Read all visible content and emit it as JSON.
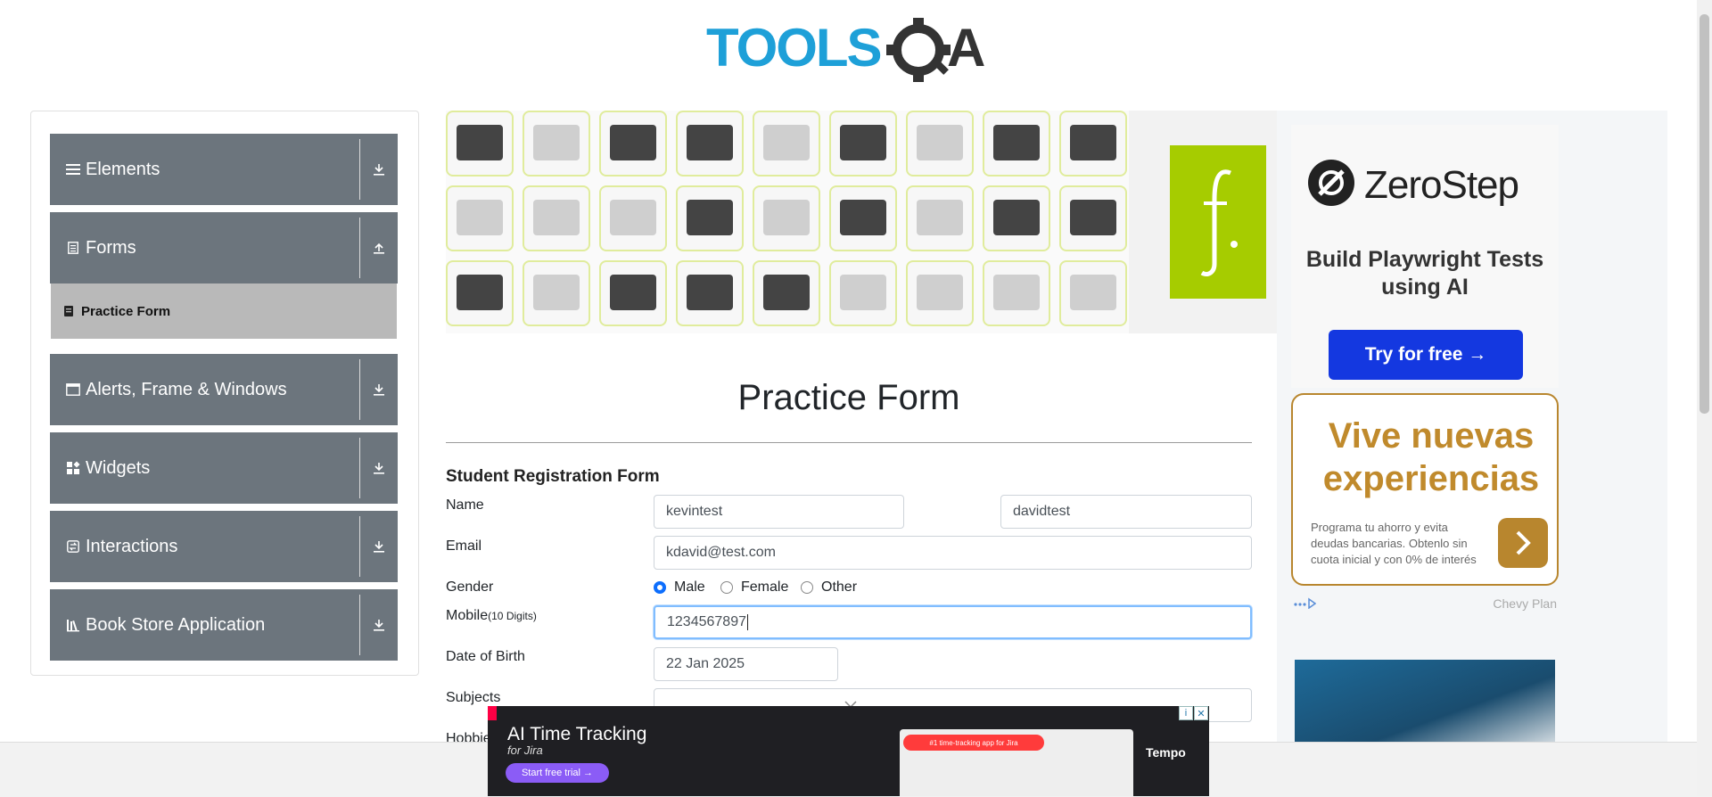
{
  "logo": {
    "text": "TOOLSQA",
    "left_part": "TOOLS",
    "right_part": "A"
  },
  "sidebar": {
    "groups": [
      {
        "label": "Elements",
        "icon": "hamburger-icon",
        "arrow": "download-icon"
      },
      {
        "label": "Forms",
        "icon": "document-icon",
        "arrow": "upload-icon"
      },
      {
        "label": "Alerts, Frame & Windows",
        "icon": "window-icon",
        "arrow": "download-icon"
      },
      {
        "label": "Widgets",
        "icon": "widgets-icon",
        "arrow": "download-icon"
      },
      {
        "label": "Interactions",
        "icon": "interaction-icon",
        "arrow": "download-icon"
      },
      {
        "label": "Book Store Application",
        "icon": "books-icon",
        "arrow": "download-icon"
      }
    ],
    "active_item": "Practice Form"
  },
  "form": {
    "title": "Practice Form",
    "subtitle": "Student Registration Form",
    "labels": {
      "name": "Name",
      "email": "Email",
      "gender": "Gender",
      "mobile": "Mobile",
      "mobile_hint": "(10 Digits)",
      "dob": "Date of Birth",
      "subjects": "Subjects",
      "hobbies": "Hobbie"
    },
    "first_name": "kevintest",
    "last_name": "davidtest",
    "email": "kdavid@test.com",
    "gender_options": [
      "Male",
      "Female",
      "Other"
    ],
    "gender_selected": "Male",
    "mobile": "1234567897",
    "dob": "22 Jan 2025",
    "subjects": ""
  },
  "ads": {
    "zerostep": {
      "brand": "ZeroStep",
      "tagline": "Build Playwright Tests using AI",
      "cta": "Try for free →"
    },
    "vive": {
      "title": "Vive nuevas experiencias",
      "desc": "Programa tu ahorro y evita deudas bancarias. Obtenlo sin cuota inicial y con 0% de interés",
      "sponsor": "Chevy Plan"
    },
    "bottom": {
      "headline": "AI Time Tracking",
      "sub": "for  Jira",
      "cta": "Start free trial →",
      "pill": "#1 time-tracking app for Jira",
      "brand": "Tempo"
    }
  },
  "colors": {
    "sidebar_bg": "#6c757d",
    "active_item_bg": "#b9b9b9",
    "logo_blue": "#1ea0d8",
    "cta_blue": "#1438e0",
    "radio_blue": "#0d6efd"
  }
}
